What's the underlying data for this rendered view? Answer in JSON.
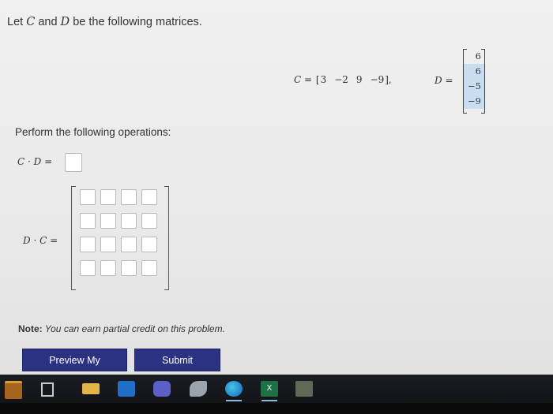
{
  "intro": {
    "prefix": "Let ",
    "var1": "C",
    "mid": " and ",
    "var2": "D",
    "suffix": " be the following matrices."
  },
  "c_vector": {
    "label": "C",
    "eq": " = ",
    "open": "[",
    "entries": [
      "3",
      "−2",
      "9",
      "−9"
    ],
    "close": "],",
    "highlighted_index": 3
  },
  "d_vector": {
    "label": "D",
    "eq": " =",
    "entries": [
      "6",
      "6",
      "−5",
      "−9"
    ],
    "highlighted_indices": [
      1,
      2,
      3
    ]
  },
  "instructions": "Perform the following operations:",
  "cd": {
    "var1": "C",
    "dot": " · ",
    "var2": "D",
    "eq": " ="
  },
  "dc": {
    "var1": "D",
    "dot": " · ",
    "var2": "C",
    "eq": " ="
  },
  "answer_grid": {
    "rows": 4,
    "cols": 4
  },
  "note": {
    "bold": "Note:",
    "text": " You can earn partial credit on this problem."
  },
  "buttons": {
    "preview": "Preview My Answers",
    "submit": "Submit Answers"
  },
  "taskbar": {
    "icons": [
      "store-icon",
      "task-view-icon",
      "file-explorer-icon",
      "outlook-icon",
      "teams-icon",
      "feather-app-icon",
      "edge-icon",
      "excel-icon",
      "calculator-icon"
    ],
    "excel_glyph": "X"
  },
  "colors": {
    "button_bg": "#2b3282",
    "highlight": "#c9dff1",
    "taskbar": "#16191d"
  }
}
